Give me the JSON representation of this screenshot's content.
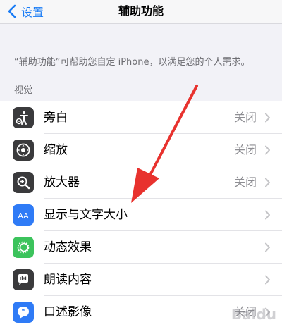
{
  "nav": {
    "back_label": "设置",
    "title": "辅助功能"
  },
  "description": "“辅助功能”可帮助您自定 iPhone，以满足您的个人需求。",
  "section_header": "视觉",
  "items": [
    {
      "label": "旁白",
      "value": "关闭",
      "icon": "voiceover-icon",
      "icon_bg": "#3a3a3c"
    },
    {
      "label": "缩放",
      "value": "关闭",
      "icon": "zoom-icon",
      "icon_bg": "#3a3a3c"
    },
    {
      "label": "放大器",
      "value": "关闭",
      "icon": "magnifier-icon",
      "icon_bg": "#3a3a3c"
    },
    {
      "label": "显示与文字大小",
      "value": "",
      "icon": "text-size-icon",
      "icon_bg": "#2f7bf6"
    },
    {
      "label": "动态效果",
      "value": "",
      "icon": "motion-icon",
      "icon_bg": "#3cc35c"
    },
    {
      "label": "朗读内容",
      "value": "",
      "icon": "spoken-content-icon",
      "icon_bg": "#3a3a3c"
    },
    {
      "label": "口述影像",
      "value": "关闭",
      "icon": "audio-description-icon",
      "icon_bg": "#2f7bf6"
    }
  ],
  "colors": {
    "accent": "#1a7cf5",
    "annotation_arrow": "#e8322e"
  },
  "watermark_text": "Baidu"
}
